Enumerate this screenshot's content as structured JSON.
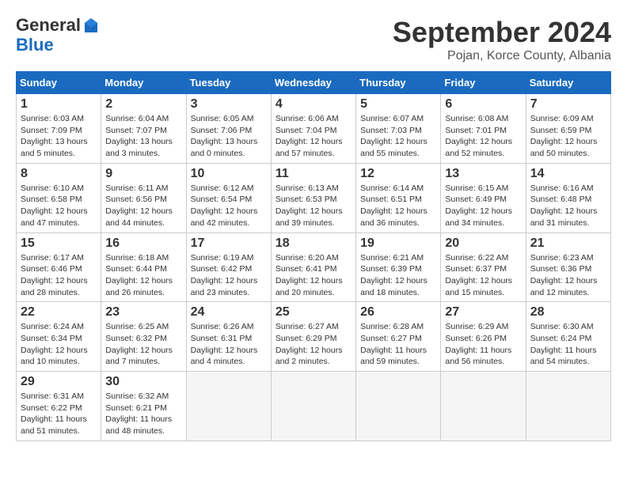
{
  "header": {
    "logo_general": "General",
    "logo_blue": "Blue",
    "month_title": "September 2024",
    "location": "Pojan, Korce County, Albania"
  },
  "weekdays": [
    "Sunday",
    "Monday",
    "Tuesday",
    "Wednesday",
    "Thursday",
    "Friday",
    "Saturday"
  ],
  "weeks": [
    [
      {
        "day": "1",
        "sunrise": "6:03 AM",
        "sunset": "7:09 PM",
        "daylight": "13 hours and 5 minutes."
      },
      {
        "day": "2",
        "sunrise": "6:04 AM",
        "sunset": "7:07 PM",
        "daylight": "13 hours and 3 minutes."
      },
      {
        "day": "3",
        "sunrise": "6:05 AM",
        "sunset": "7:06 PM",
        "daylight": "13 hours and 0 minutes."
      },
      {
        "day": "4",
        "sunrise": "6:06 AM",
        "sunset": "7:04 PM",
        "daylight": "12 hours and 57 minutes."
      },
      {
        "day": "5",
        "sunrise": "6:07 AM",
        "sunset": "7:03 PM",
        "daylight": "12 hours and 55 minutes."
      },
      {
        "day": "6",
        "sunrise": "6:08 AM",
        "sunset": "7:01 PM",
        "daylight": "12 hours and 52 minutes."
      },
      {
        "day": "7",
        "sunrise": "6:09 AM",
        "sunset": "6:59 PM",
        "daylight": "12 hours and 50 minutes."
      }
    ],
    [
      {
        "day": "8",
        "sunrise": "6:10 AM",
        "sunset": "6:58 PM",
        "daylight": "12 hours and 47 minutes."
      },
      {
        "day": "9",
        "sunrise": "6:11 AM",
        "sunset": "6:56 PM",
        "daylight": "12 hours and 44 minutes."
      },
      {
        "day": "10",
        "sunrise": "6:12 AM",
        "sunset": "6:54 PM",
        "daylight": "12 hours and 42 minutes."
      },
      {
        "day": "11",
        "sunrise": "6:13 AM",
        "sunset": "6:53 PM",
        "daylight": "12 hours and 39 minutes."
      },
      {
        "day": "12",
        "sunrise": "6:14 AM",
        "sunset": "6:51 PM",
        "daylight": "12 hours and 36 minutes."
      },
      {
        "day": "13",
        "sunrise": "6:15 AM",
        "sunset": "6:49 PM",
        "daylight": "12 hours and 34 minutes."
      },
      {
        "day": "14",
        "sunrise": "6:16 AM",
        "sunset": "6:48 PM",
        "daylight": "12 hours and 31 minutes."
      }
    ],
    [
      {
        "day": "15",
        "sunrise": "6:17 AM",
        "sunset": "6:46 PM",
        "daylight": "12 hours and 28 minutes."
      },
      {
        "day": "16",
        "sunrise": "6:18 AM",
        "sunset": "6:44 PM",
        "daylight": "12 hours and 26 minutes."
      },
      {
        "day": "17",
        "sunrise": "6:19 AM",
        "sunset": "6:42 PM",
        "daylight": "12 hours and 23 minutes."
      },
      {
        "day": "18",
        "sunrise": "6:20 AM",
        "sunset": "6:41 PM",
        "daylight": "12 hours and 20 minutes."
      },
      {
        "day": "19",
        "sunrise": "6:21 AM",
        "sunset": "6:39 PM",
        "daylight": "12 hours and 18 minutes."
      },
      {
        "day": "20",
        "sunrise": "6:22 AM",
        "sunset": "6:37 PM",
        "daylight": "12 hours and 15 minutes."
      },
      {
        "day": "21",
        "sunrise": "6:23 AM",
        "sunset": "6:36 PM",
        "daylight": "12 hours and 12 minutes."
      }
    ],
    [
      {
        "day": "22",
        "sunrise": "6:24 AM",
        "sunset": "6:34 PM",
        "daylight": "12 hours and 10 minutes."
      },
      {
        "day": "23",
        "sunrise": "6:25 AM",
        "sunset": "6:32 PM",
        "daylight": "12 hours and 7 minutes."
      },
      {
        "day": "24",
        "sunrise": "6:26 AM",
        "sunset": "6:31 PM",
        "daylight": "12 hours and 4 minutes."
      },
      {
        "day": "25",
        "sunrise": "6:27 AM",
        "sunset": "6:29 PM",
        "daylight": "12 hours and 2 minutes."
      },
      {
        "day": "26",
        "sunrise": "6:28 AM",
        "sunset": "6:27 PM",
        "daylight": "11 hours and 59 minutes."
      },
      {
        "day": "27",
        "sunrise": "6:29 AM",
        "sunset": "6:26 PM",
        "daylight": "11 hours and 56 minutes."
      },
      {
        "day": "28",
        "sunrise": "6:30 AM",
        "sunset": "6:24 PM",
        "daylight": "11 hours and 54 minutes."
      }
    ],
    [
      {
        "day": "29",
        "sunrise": "6:31 AM",
        "sunset": "6:22 PM",
        "daylight": "11 hours and 51 minutes."
      },
      {
        "day": "30",
        "sunrise": "6:32 AM",
        "sunset": "6:21 PM",
        "daylight": "11 hours and 48 minutes."
      },
      null,
      null,
      null,
      null,
      null
    ]
  ]
}
